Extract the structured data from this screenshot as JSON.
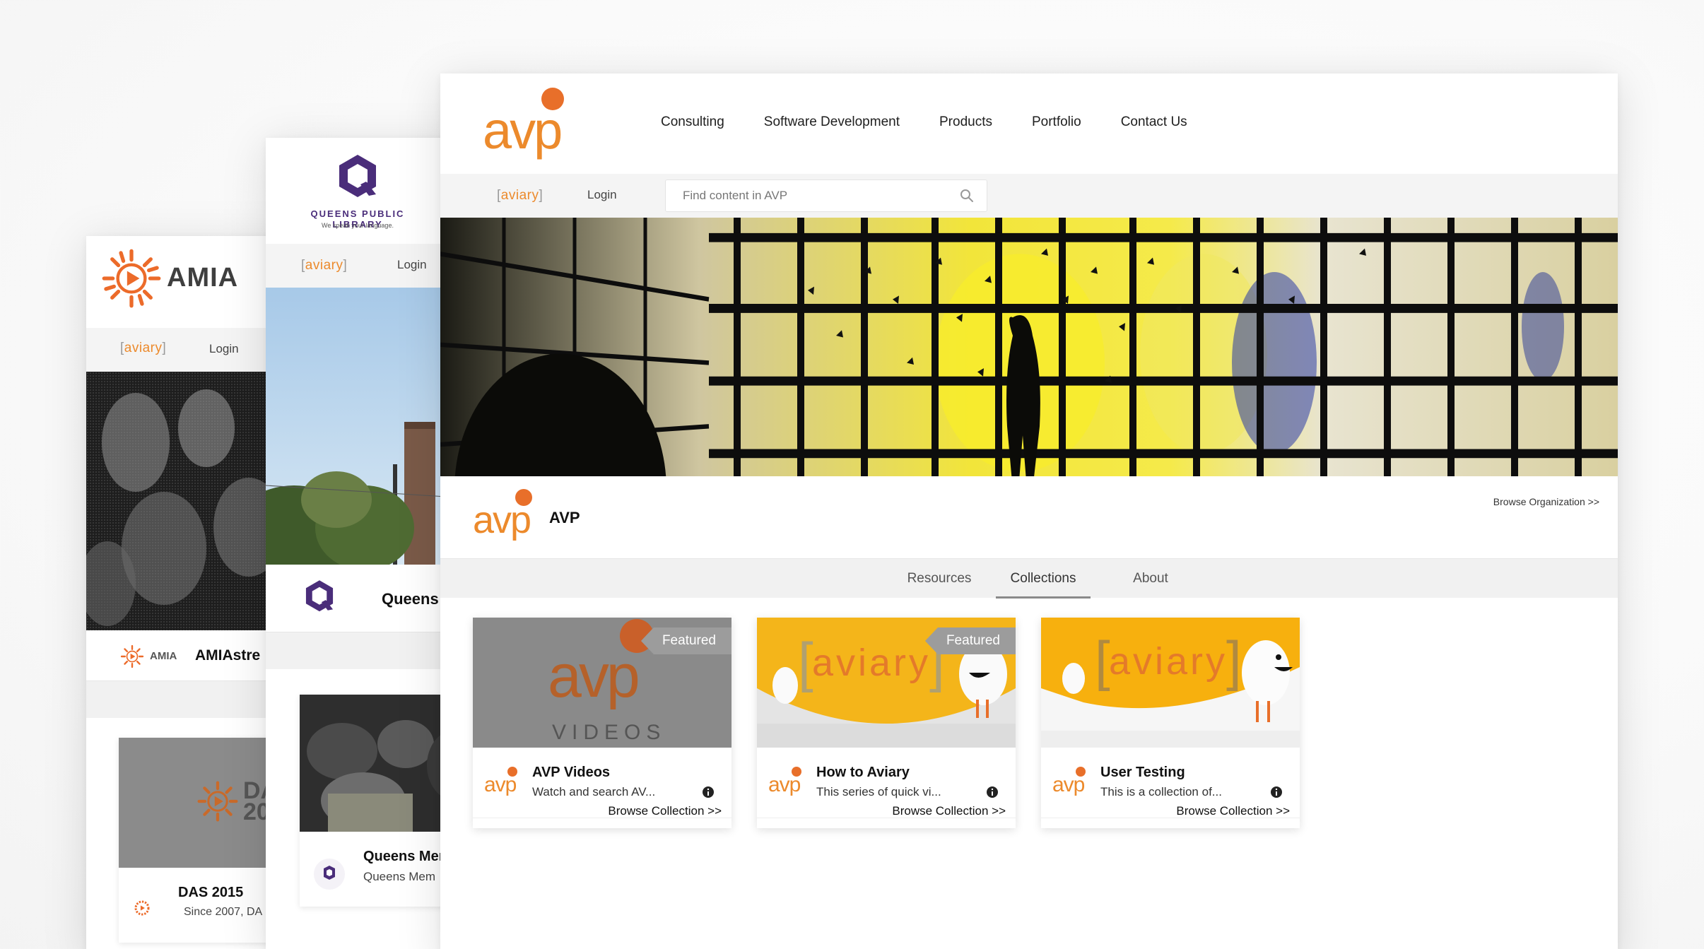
{
  "colors": {
    "brand_orange": "#ec8a2c",
    "avp_dot_orange": "#e86f2a",
    "queens_purple": "#4a2d7a",
    "badge_gray": "#9c9c9c"
  },
  "amia_window": {
    "logo_text": "AMIA",
    "aviary_tag": "aviary",
    "login_label": "Login",
    "org_logo_text": "AMIA",
    "org_name": "AMIAstre",
    "card": {
      "thumb_text": "DA\n20",
      "title": "DAS 2015",
      "description": "Since 2007, DA"
    }
  },
  "queens_window": {
    "logo_name": "QUEENS PUBLIC LIBRARY",
    "logo_tagline": "We speak your language.",
    "aviary_tag": "aviary",
    "login_label": "Login",
    "org_name": "Queens",
    "card": {
      "title": "Queens Mer",
      "description": "Queens Mem"
    }
  },
  "avp_window": {
    "logo_text": "avp",
    "nav": [
      "Consulting",
      "Software Development",
      "Products",
      "Portfolio",
      "Contact Us"
    ],
    "aviary_tag": "aviary",
    "login_label": "Login",
    "search_placeholder": "Find content in AVP",
    "org_name": "AVP",
    "browse_org_label": "Browse Organization >>",
    "tabs": [
      "Resources",
      "Collections",
      "About"
    ],
    "active_tab": "Collections",
    "collections": [
      {
        "title": "AVP Videos",
        "description": "Watch and search AV...",
        "featured": "Featured",
        "thumb_text": "VIDEOS",
        "browse_label": "Browse Collection >>"
      },
      {
        "title": "How to Aviary",
        "description": "This series of quick vi...",
        "featured": "Featured",
        "thumb_text": "aviary",
        "browse_label": "Browse Collection >>"
      },
      {
        "title": "User Testing",
        "description": "This is a collection of...",
        "featured": "",
        "thumb_text": "aviary",
        "browse_label": "Browse Collection >>"
      }
    ]
  },
  "icons": [
    "search-icon",
    "info-icon",
    "avp-logo-icon",
    "amia-burst-icon",
    "queens-q-icon"
  ]
}
